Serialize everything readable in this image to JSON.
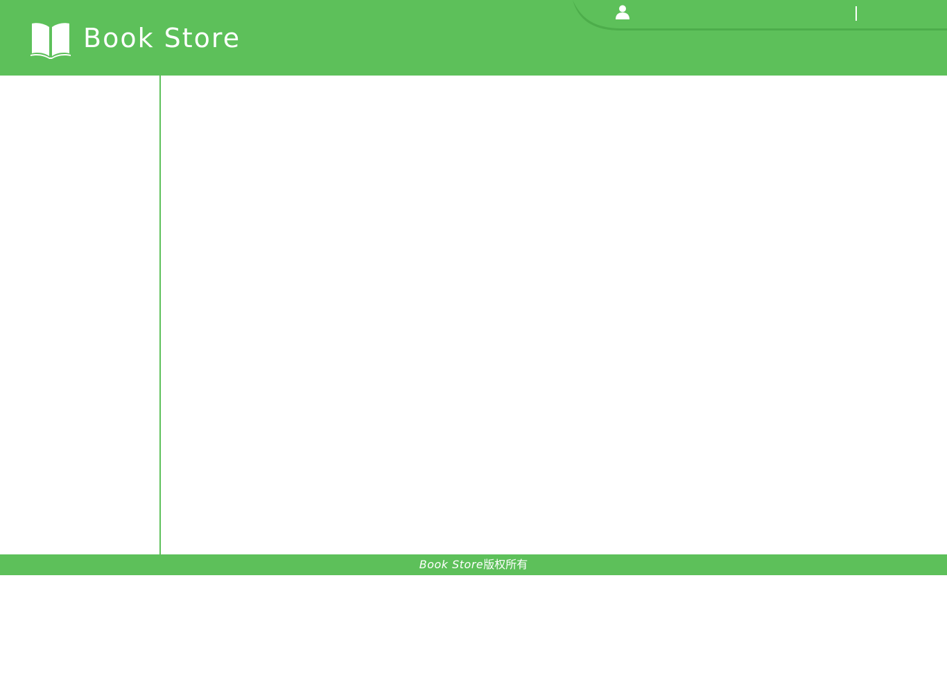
{
  "header": {
    "logo_text": "Book Store",
    "logo_icon": "open-book-icon",
    "user_icon": "user-icon",
    "user_name": "",
    "logout_label": ""
  },
  "footer": {
    "brand": "Book Store",
    "copyright_suffix": "版权所有"
  },
  "colors": {
    "brand_green": "#5dc05a",
    "bar_green": "#5dc05a",
    "bar_shadow": "#4aa847",
    "text_on_brand": "#ffffff"
  }
}
